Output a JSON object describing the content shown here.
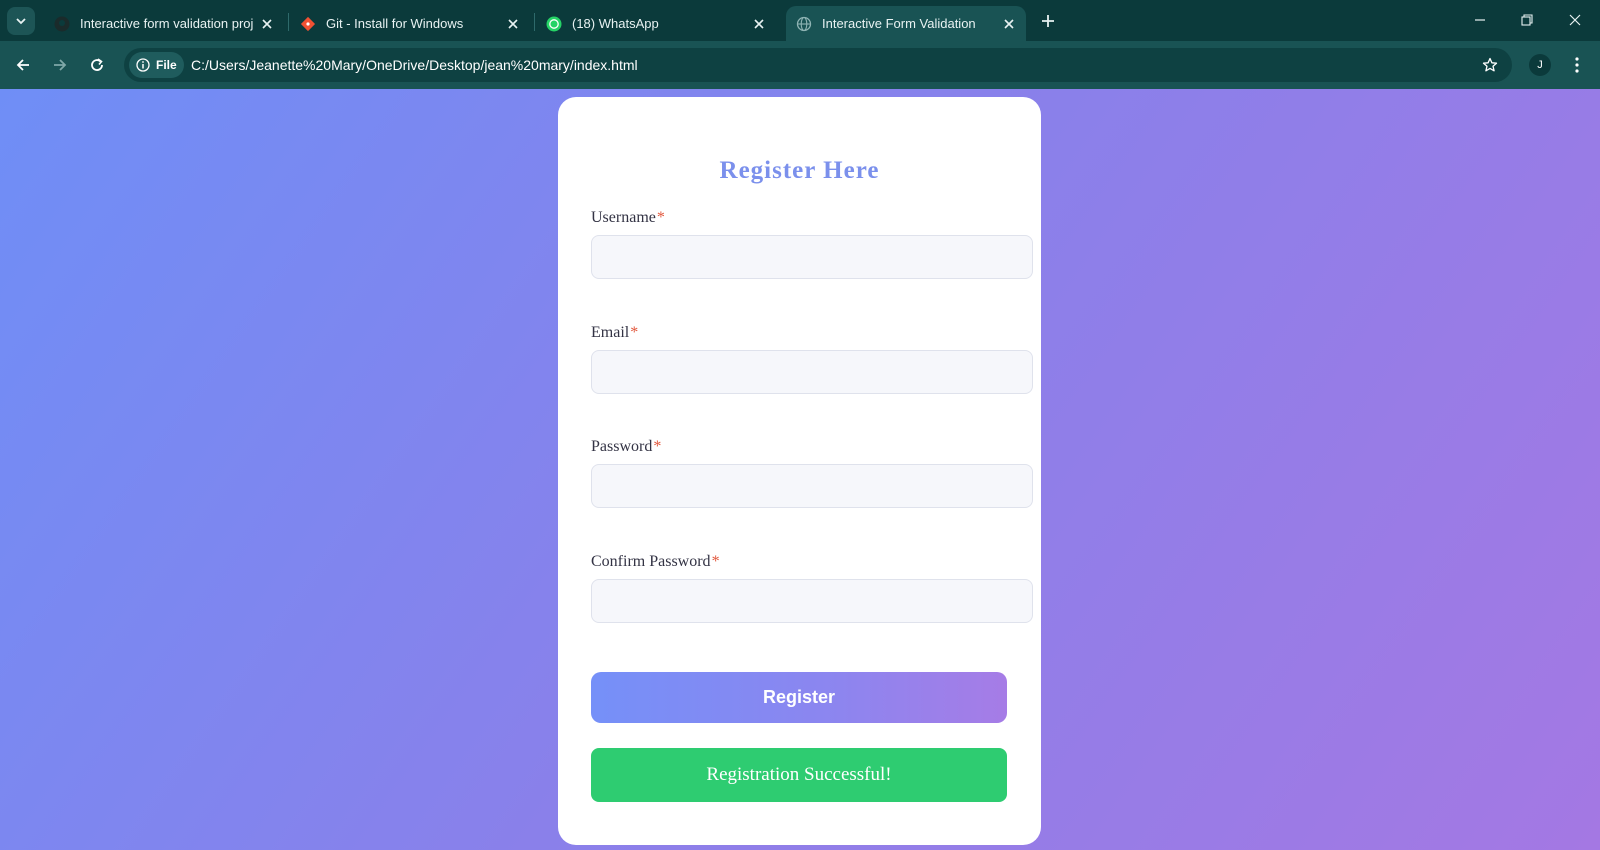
{
  "browser": {
    "tabs": [
      {
        "title": "Interactive form validation proj",
        "favicon": "github-icon"
      },
      {
        "title": "Git - Install for Windows",
        "favicon": "git-icon"
      },
      {
        "title": "(18) WhatsApp",
        "favicon": "whatsapp-icon"
      },
      {
        "title": "Interactive Form Validation",
        "favicon": "globe-icon",
        "active": true
      }
    ],
    "address_bar": {
      "scheme_chip": "File",
      "url": "C:/Users/Jeanette%20Mary/OneDrive/Desktop/jean%20mary/index.html"
    },
    "profile_initial": "J"
  },
  "form": {
    "heading": "Register Here",
    "required_marker": "*",
    "fields": [
      {
        "label": "Username",
        "value": ""
      },
      {
        "label": "Email",
        "value": ""
      },
      {
        "label": "Password",
        "value": ""
      },
      {
        "label": "Confirm Password",
        "value": ""
      }
    ],
    "submit_label": "Register",
    "success_message": "Registration Successful!"
  },
  "colors": {
    "heading": "#7b90ec",
    "required": "#e2573c",
    "success": "#2ecc71",
    "gradient_start": "#6f8ef6",
    "gradient_end": "#a478e3"
  }
}
